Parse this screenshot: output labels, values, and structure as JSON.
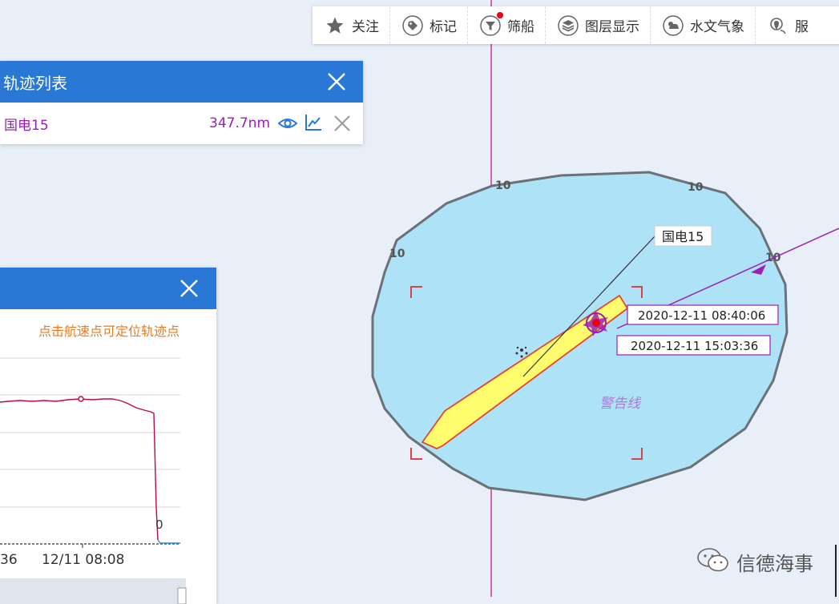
{
  "toolbar": {
    "items": [
      {
        "label": "关注",
        "icon": "star-icon"
      },
      {
        "label": "标记",
        "icon": "tag-icon"
      },
      {
        "label": "筛船",
        "icon": "filter-icon"
      },
      {
        "label": "图层显示",
        "icon": "layers-icon"
      },
      {
        "label": "水文气象",
        "icon": "weather-icon"
      },
      {
        "label": "服",
        "icon": "service-icon"
      }
    ]
  },
  "track_panel": {
    "title": "轨迹列表",
    "row": {
      "name": "国电15",
      "distance": "347.7nm"
    }
  },
  "chart_panel": {
    "hint": "点击航速点可定位轨迹点",
    "tick_labels": [
      "36",
      "12/11 08:08"
    ],
    "end_value_label": "0"
  },
  "map": {
    "ship_label": "国电15",
    "time_start": "2020-12-11 08:40:06",
    "time_end": "2020-12-11 15:03:36",
    "depth_labels": [
      "10",
      "10",
      "10",
      "10"
    ],
    "warning_text": "警告线"
  },
  "watermark": {
    "text": "信德海事"
  },
  "colors": {
    "header_blue": "#2a78d6",
    "track_purple": "#9b1fb8",
    "zone_fill": "#aee3f7",
    "ship_yellow": "#fffd6e",
    "hint_orange": "#ec7a1c"
  }
}
